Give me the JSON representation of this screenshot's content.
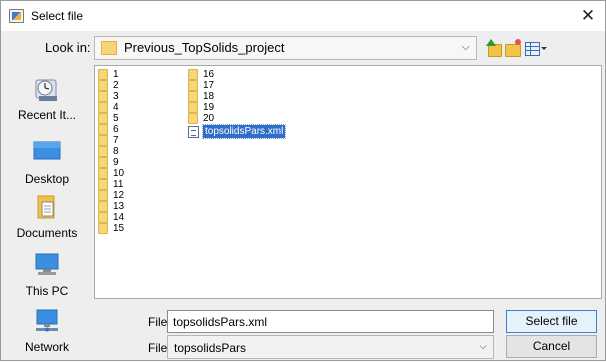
{
  "window": {
    "title": "Select file",
    "close_glyph": "✕"
  },
  "look_in": {
    "label": "Look in:",
    "value": "Previous_TopSolids_project",
    "arrow_glyph": "⌵"
  },
  "toolbar": {
    "icons": [
      "up-one-level-icon",
      "new-folder-icon",
      "view-menu-icon"
    ]
  },
  "places": [
    {
      "label": "Recent It...",
      "icon": "recent-items-icon"
    },
    {
      "label": "Desktop",
      "icon": "desktop-icon"
    },
    {
      "label": "Documents",
      "icon": "documents-icon"
    },
    {
      "label": "This PC",
      "icon": "this-pc-icon"
    },
    {
      "label": "Network",
      "icon": "network-icon"
    }
  ],
  "files": {
    "column1": [
      "1",
      "2",
      "3",
      "4",
      "5",
      "6",
      "7",
      "8",
      "9",
      "10",
      "11",
      "12",
      "13",
      "14",
      "15"
    ],
    "column2": [
      "16",
      "17",
      "18",
      "19",
      "20"
    ],
    "selected_file": "topsolidsPars.xml"
  },
  "form": {
    "file_name_label": "File name:",
    "file_name_value": "topsolidsPars.xml",
    "file_type_label": "Files of type:",
    "file_type_value": "topsolidsPars",
    "arrow_glyph": "⌵"
  },
  "buttons": {
    "select": "Select file",
    "cancel": "Cancel"
  },
  "colors": {
    "selection": "#2f6fca",
    "folder": "#f7d774",
    "window_bg": "#eeeeee"
  }
}
